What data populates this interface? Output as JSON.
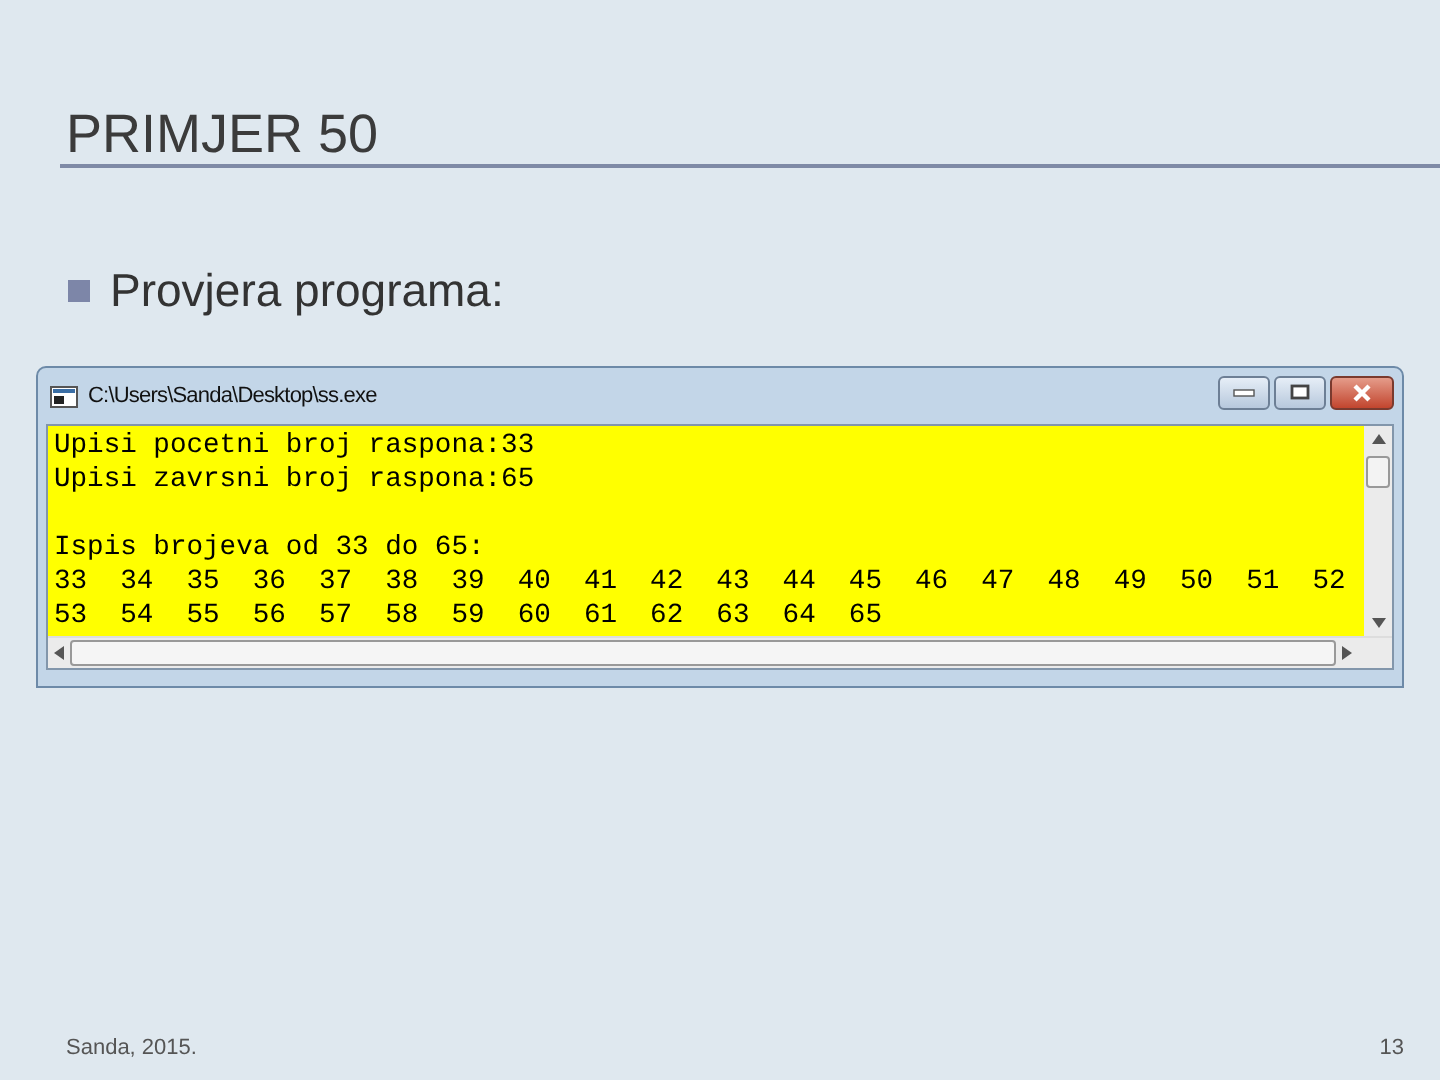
{
  "slide": {
    "title": "PRIMJER 50",
    "bullets": [
      "Provjera programa:"
    ]
  },
  "console_window": {
    "title": "C:\\Users\\Sanda\\Desktop\\ss.exe",
    "output_blocks": [
      [
        "Upisi pocetni broj raspona:33",
        "Upisi zavrsni broj raspona:65"
      ],
      [
        "Ispis brojeva od 33 do 65:",
        "33  34  35  36  37  38  39  40  41  42  43  44  45  46  47  48  49  50  51  52",
        "53  54  55  56  57  58  59  60  61  62  63  64  65"
      ]
    ]
  },
  "footer": {
    "author": "Sanda, 2015.",
    "page_number": "13"
  }
}
